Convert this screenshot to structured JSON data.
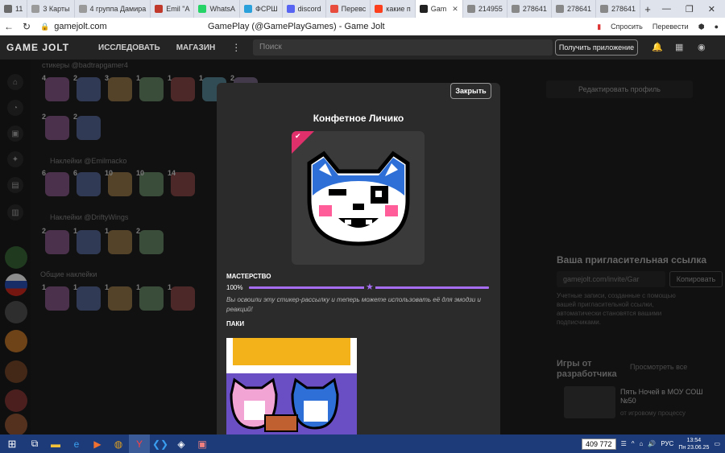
{
  "browser": {
    "tabs": [
      {
        "label": "11",
        "icon": "tab-count",
        "color": "#6a6a6a"
      },
      {
        "label": "3 Карты",
        "icon": "maps-icon",
        "color": "#9a9a9a"
      },
      {
        "label": "4 группа Дамира",
        "icon": "group-icon",
        "color": "#9a9a9a"
      },
      {
        "label": "Emil \"A",
        "icon": "site-icon",
        "color": "#c0392b"
      },
      {
        "label": "WhatsA",
        "icon": "whatsapp-icon",
        "color": "#25d366"
      },
      {
        "label": "ФСРШ",
        "icon": "telegram-icon",
        "color": "#2aa1da"
      },
      {
        "label": "discord",
        "icon": "discord-icon",
        "color": "#5865f2"
      },
      {
        "label": "Перевс",
        "icon": "translate-icon",
        "color": "#e74c3c"
      },
      {
        "label": "какие п",
        "icon": "yandex-icon",
        "color": "#fc3f1d"
      },
      {
        "label": "Gam",
        "icon": "gamejolt-icon",
        "color": "#222",
        "active": true
      },
      {
        "label": "214955",
        "icon": "doc-icon",
        "color": "#888"
      },
      {
        "label": "278641",
        "icon": "doc-icon",
        "color": "#888"
      },
      {
        "label": "278641",
        "icon": "doc-icon",
        "color": "#888"
      },
      {
        "label": "278641",
        "icon": "doc-icon",
        "color": "#888"
      }
    ],
    "url": "gamejolt.com",
    "page_title": "GamePlay (@GamePlayGames) - Game Jolt",
    "ask_label": "Спросить",
    "translate_label": "Перевести"
  },
  "header": {
    "logo": "GAME JOLT",
    "explore": "ИССЛЕДОВАТЬ",
    "store": "МАГАЗИН",
    "search_placeholder": "Поиск",
    "get_app": "Получить приложение"
  },
  "background": {
    "section_stickers": "стикеры @badtrapgamer4",
    "section_emilmacko": "Наклейки @Emilmacko",
    "section_driftywings": "Наклейки @DriftyWings",
    "section_common": "Общие наклейки",
    "counts_row1": [
      "4",
      "2",
      "3",
      "1",
      "1",
      "1",
      "2"
    ],
    "counts_row2": [
      "2",
      "2"
    ],
    "counts_row3": [
      "6",
      "6",
      "10",
      "10",
      "14"
    ],
    "counts_row4": [
      "2",
      "1",
      "1",
      "2"
    ],
    "counts_row5": [
      "1",
      "1",
      "1",
      "1",
      "1"
    ],
    "edit_profile": "Редактировать профиль",
    "referral_title": "Ваша пригласительная ссылка",
    "referral_link": "gamejolt.com/invite/Gar",
    "copy_label": "Копировать",
    "referral_desc": "Учетные записи, созданные с помощью вашей пригласительной ссылки, автоматически становятся вашими подписчиками.",
    "dev_games_title": "Игры от разработчика",
    "see_all": "Просмотреть все",
    "game_name": "Пять Ночей в МОУ СОШ №50",
    "game_sub": "от игровому процессу"
  },
  "modal": {
    "close": "Закрыть",
    "title": "Конфетное Личико",
    "mastery_label": "МАСТЕРСТВО",
    "mastery_pct": "100%",
    "mastery_value": 1.0,
    "mastery_desc": "Вы освоили эту стикер-рассылку и теперь можете использовать её для эмодзи и реакций!",
    "packs_label": "ПАКИ"
  },
  "taskbar": {
    "counter": "409 772",
    "lang": "РУС",
    "time": "13:54",
    "date": "Пн 23.06.25"
  },
  "colors": {
    "accent_purple": "#a66df0",
    "ribbon_pink": "#e0306b",
    "mascot_blue": "#2d6fd6",
    "taskbar_blue": "#1d3b78"
  }
}
